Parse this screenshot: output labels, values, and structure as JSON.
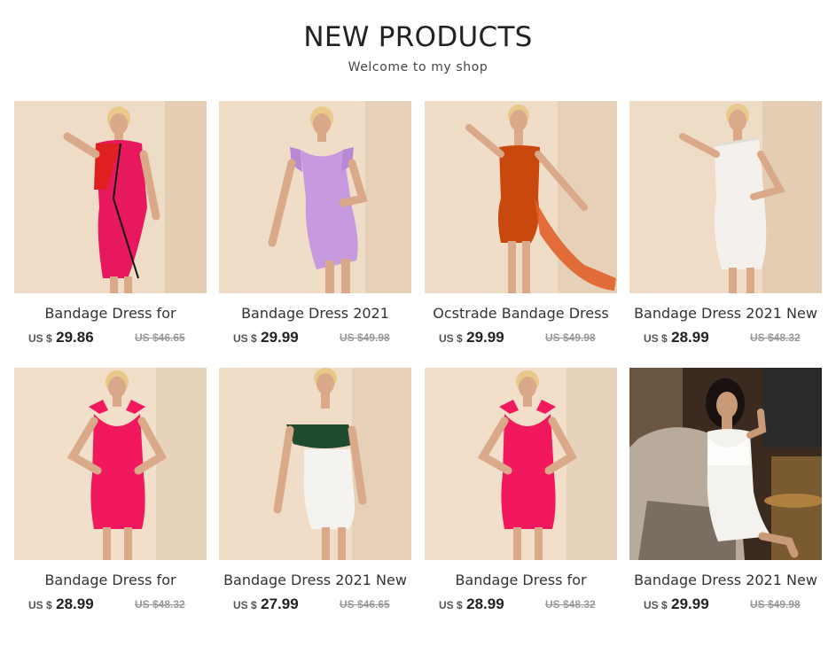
{
  "header": {
    "title": "NEW PRODUCTS",
    "subtitle": "Welcome to my shop"
  },
  "currency_prefix": "US $",
  "products": [
    {
      "name": "Bandage Dress for",
      "price": "29.86",
      "old_price": "US $46.65",
      "dress_color": "#e8185e",
      "accent": "#e02020"
    },
    {
      "name": "Bandage Dress 2021",
      "price": "29.99",
      "old_price": "US $49.98",
      "dress_color": "#c79ae0",
      "accent": "#b888d6"
    },
    {
      "name": "Ocstrade Bandage Dress",
      "price": "29.99",
      "old_price": "US $49.98",
      "dress_color": "#c8480e",
      "accent": "#e0602a"
    },
    {
      "name": "Bandage Dress 2021 New",
      "price": "28.99",
      "old_price": "US $48.32",
      "dress_color": "#f4f1ec",
      "accent": "#e2dcd2"
    },
    {
      "name": "Bandage Dress for",
      "price": "28.99",
      "old_price": "US $48.32",
      "dress_color": "#f2185e",
      "accent": "#e01050"
    },
    {
      "name": "Bandage Dress 2021 New",
      "price": "27.99",
      "old_price": "US $46.65",
      "dress_color": "#f5f3ef",
      "accent": "#1e4a2e"
    },
    {
      "name": "Bandage Dress for",
      "price": "28.99",
      "old_price": "US $48.32",
      "dress_color": "#f2185e",
      "accent": "#e01050"
    },
    {
      "name": "Bandage Dress 2021 New",
      "price": "29.99",
      "old_price": "US $49.98",
      "dress_color": "#f4f2ee",
      "accent": "#8a7a6a"
    }
  ]
}
